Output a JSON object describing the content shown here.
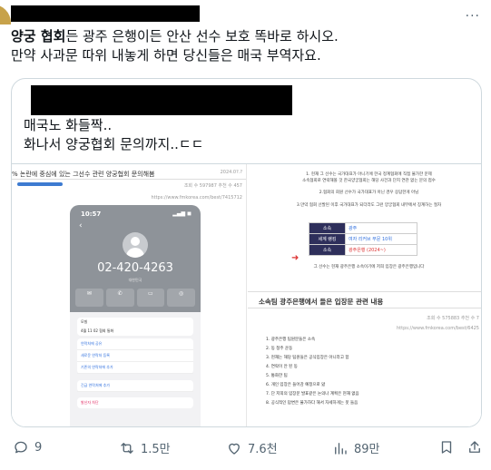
{
  "tweet": {
    "line1_bold": "양궁 협회",
    "line1_rest": "든 광주 은행이든 안산 선수 보호 똑바로 하시오.",
    "line2": "만약 사과문 따위 내놓게 하면 당신들은 매국 부역자요."
  },
  "quote": {
    "line1": "매국노 화들짝..",
    "line2": "화나서 양궁협회 문의까지..ㄷㄷ"
  },
  "left_image": {
    "title": "% 논란에 중심에 있는 그선수 관련 양궁협회 문의해봄",
    "date": "2024.0?.?",
    "meta": "조회 수 597987  추천 수 457",
    "url": "https://www.fmkorea.com/best/7415712",
    "time": "10:57",
    "number": "02-420-4263",
    "sub": "대한민국",
    "actions": [
      "메시지",
      "통화",
      "영상",
      "음성"
    ],
    "card1": [
      "모빌",
      "4월 11 02 협회 통화"
    ],
    "links": [
      "연락처에 공유",
      "새로운 연락처 등록",
      "기존의 연락처에 추가"
    ],
    "emergency": "긴급 연락처에 추가",
    "block": "발신자 차단"
  },
  "right_image": {
    "intro": [
      "1. 현재 그 선수는 국가대표가 아니기에 한국 정계협회에 직접 불가한 문제",
      "소속협회로 연락해볼 것 한국양궁협회는 해당 사건과 단지 연관 없는 문의 접수",
      "2.협회의 회원 선수가 국가대표가 아닌 경우 응답한게 아님",
      "3.만약 협회 선발된 이후 국가대표가 되더라도 그런 양궁협회 내부에서 징계하는 절차"
    ],
    "table": [
      {
        "k": "소속",
        "v": "광주"
      },
      {
        "k": "세계 랭킹",
        "v": "여자 리커브 부문 10위"
      },
      {
        "k": "소속",
        "v": "광주은행 (2024~)"
      }
    ],
    "after_table": "그 선수는 현재 광주은행 소속이기에 저희 입장은 광주은행입니다",
    "heading": "소속팀 광주은행에서 들은 입장문 관련 내용",
    "meta": "조회 수 575883  추천 수 7",
    "url": "https://www.fmkorea.com/best/6425",
    "list": [
      "1. 광주은행 팀원분들은 소속",
      "2. 동 청주 운동",
      "3. 현재는 해당 팀원들은 공식입장은 아니라고 함",
      "4. 연락이 안 된 동",
      "5. 통화한 팀",
      "6. 개인 입장은 들어감 예정으로 앎",
      "7. 단 저희의 입장문 발표같은 논의나 계획은 현재 없음",
      "8. 공식적인 답변은 불가하다 해서 자세하게는 못 들음"
    ]
  },
  "actions": {
    "replies": "9",
    "retweets": "1.5만",
    "likes": "7.6천",
    "views": "89만"
  }
}
